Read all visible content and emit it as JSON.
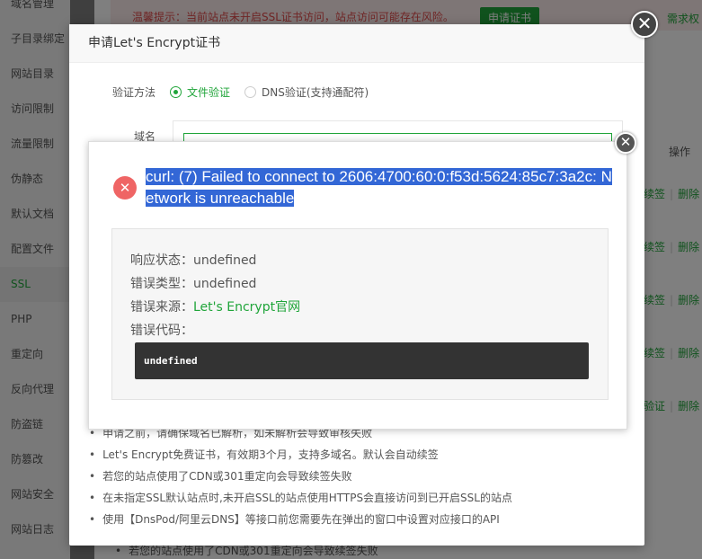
{
  "sidebar": {
    "items": [
      {
        "label": "域名管理"
      },
      {
        "label": "子目录绑定"
      },
      {
        "label": "网站目录"
      },
      {
        "label": "访问限制"
      },
      {
        "label": "流量限制"
      },
      {
        "label": "伪静态"
      },
      {
        "label": "默认文档"
      },
      {
        "label": "配置文件"
      },
      {
        "label": "SSL",
        "active": true
      },
      {
        "label": "PHP"
      },
      {
        "label": "重定向"
      },
      {
        "label": "反向代理"
      },
      {
        "label": "防盗链"
      },
      {
        "label": "防篡改"
      },
      {
        "label": "网站安全"
      },
      {
        "label": "网站日志"
      }
    ]
  },
  "background": {
    "warning_text": "温馨提示：当前站点未开启SSL证书访问，站点访问可能存在风险。",
    "apply_button": "申请证书",
    "renew_link": "需求权",
    "op_header": "操作",
    "row_actions": [
      {
        "primary": "续签",
        "delete": "删除"
      },
      {
        "primary": "续签",
        "delete": "删除"
      },
      {
        "primary": "续签",
        "delete": "删除"
      },
      {
        "primary": "续签",
        "delete": "删除"
      },
      {
        "primary": "验证",
        "delete": "删除"
      }
    ],
    "bottom_note": "若您的站点使用了CDN或301重定向会导致续签失败"
  },
  "ssl_modal": {
    "title": "申请Let's Encrypt证书",
    "close_glyph": "✕",
    "verify_label": "验证方法",
    "verify_options": [
      {
        "label": "文件验证",
        "checked": true
      },
      {
        "label": "DNS验证(支持通配符)",
        "checked": false
      }
    ],
    "domain_label": "域名",
    "notes": [
      "申请之前，请确保域名已解析，如未解析会导致审核失败",
      "Let's Encrypt免费证书，有效期3个月，支持多域名。默认会自动续签",
      "若您的站点使用了CDN或301重定向会导致续签失败",
      "在未指定SSL默认站点时,未开启SSL的站点使用HTTPS会直接访问到已开启SSL的站点",
      "使用【DnsPod/阿里云DNS】等接口前您需要先在弹出的窗口中设置对应接口的API"
    ]
  },
  "error_dialog": {
    "close_glyph": "✕",
    "icon_glyph": "✕",
    "title_line1": "curl: (7) Failed to connect to 2606:4700:60:0:f53d:5624:85c7:3a2c: N",
    "title_line2": "etwork is unreachable",
    "response_status_label": "响应状态：",
    "response_status_value": "undefined",
    "error_type_label": "错误类型：",
    "error_type_value": "undefined",
    "error_source_label": "错误来源：",
    "error_source_value": "Let's Encrypt官网",
    "error_code_label": "错误代码：",
    "error_code_value": "undefined"
  },
  "colors": {
    "accent": "#20a53a",
    "error_icon": "#ef6565",
    "selection": "#3367d6",
    "code_bg": "#333333"
  }
}
